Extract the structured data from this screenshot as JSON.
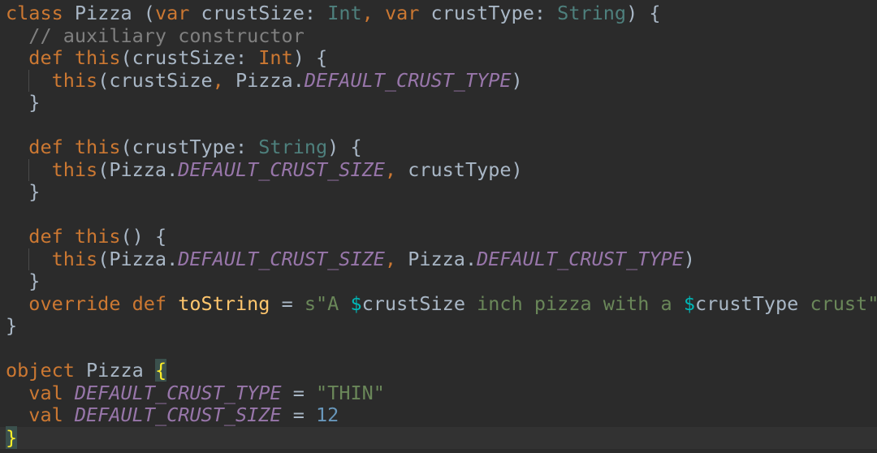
{
  "code": {
    "l1": [
      "class",
      " Pizza ",
      "(",
      "var",
      " crustSize: ",
      "Int",
      ", ",
      "var",
      " crustType: ",
      "String",
      ") {"
    ],
    "l2": [
      "  ",
      "// auxiliary constructor"
    ],
    "l3": [
      "  ",
      "def",
      " ",
      "this",
      "(crustSize: ",
      "Int",
      ") {"
    ],
    "l4": [
      "    ",
      "this",
      "(crustSize",
      ", ",
      "Pizza.",
      "DEFAULT_CRUST_TYPE",
      ")"
    ],
    "l5": [
      "  }"
    ],
    "l7": [
      "  ",
      "def",
      " ",
      "this",
      "(crustType: ",
      "String",
      ") {"
    ],
    "l8": [
      "    ",
      "this",
      "(Pizza.",
      "DEFAULT_CRUST_SIZE",
      ", ",
      "crustType)"
    ],
    "l9": [
      "  }"
    ],
    "l11": [
      "  ",
      "def",
      " ",
      "this",
      "() {"
    ],
    "l12": [
      "    ",
      "this",
      "(Pizza.",
      "DEFAULT_CRUST_SIZE",
      ", ",
      "Pizza.",
      "DEFAULT_CRUST_TYPE",
      ")"
    ],
    "l13": [
      "  }"
    ],
    "l14": [
      "  ",
      "override",
      " ",
      "def",
      " ",
      "toString",
      " = ",
      "s\"A ",
      "$",
      "crustSize",
      " inch pizza with a ",
      "$",
      "crustType",
      " crust\""
    ],
    "l15": [
      "}"
    ],
    "l17": [
      "object",
      " Pizza ",
      "{"
    ],
    "l18": [
      "  ",
      "val",
      " ",
      "DEFAULT_CRUST_TYPE",
      " = ",
      "\"THIN\""
    ],
    "l19": [
      "  ",
      "val",
      " ",
      "DEFAULT_CRUST_SIZE",
      " = ",
      "12"
    ],
    "l20": [
      "}"
    ]
  },
  "colors": {
    "background": "#2b2b2b",
    "keyword": "#cc7832",
    "type": "#4e807d",
    "comment": "#808080",
    "constant": "#9876aa",
    "string": "#6a8759",
    "number": "#6897bb",
    "function": "#ffc66d",
    "brace_match": "#ffef28"
  }
}
